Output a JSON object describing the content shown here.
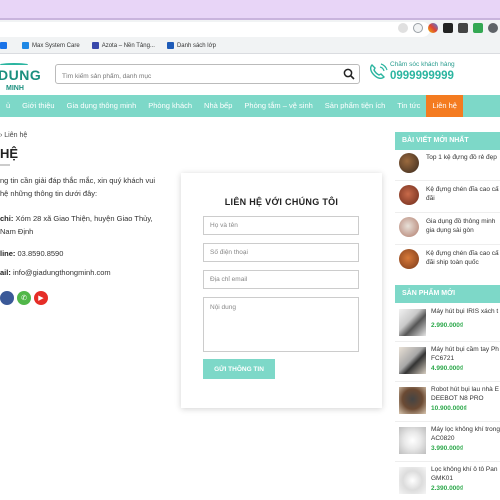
{
  "browser": {
    "bookmarks": [
      {
        "label": "",
        "color": "#1a73e8"
      },
      {
        "label": "Max System Care",
        "color": "#1e88e5"
      },
      {
        "label": "Azota – Nền Tảng...",
        "color": "#3949ab"
      },
      {
        "label": "Danh sách lớp",
        "color": "#1e5bb8"
      }
    ]
  },
  "header": {
    "logo_main": "DUNG",
    "logo_sub": "MINH",
    "search_placeholder": "Tìm kiếm sản phẩm, danh mục",
    "hotline_label": "Chăm sóc khách hàng",
    "hotline_phone": "0999999999"
  },
  "nav": {
    "items": [
      "ủ",
      "Giới thiệu",
      "Gia dụng thông minh",
      "Phòng khách",
      "Nhà bếp",
      "Phòng tắm – vệ sinh",
      "Sản phẩm tiện ích",
      "Tin tức",
      "Liên hệ"
    ],
    "active_index": 8
  },
  "content": {
    "breadcrumb": "› Liên hệ",
    "title": "HỆ",
    "intro_lines": [
      "ng tin cần giải đáp thắc mắc, xin quý khách vui",
      "hệ những thông tin dưới đây:"
    ],
    "address_label": "chỉ:",
    "address_value": "Xóm 28 xã Giao Thiện, huyện Giao Thủy,",
    "address_value2": "Nam Định",
    "hotline_label": "line:",
    "hotline_value": "03.8590.8590",
    "email_label": "ail:",
    "email_value": "info@giadungthongminh.com"
  },
  "form": {
    "title": "LIÊN HỆ VỚI CHÚNG TÔI",
    "name_placeholder": "Họ và tên",
    "phone_placeholder": "Số điện thoại",
    "email_placeholder": "Địa chỉ email",
    "message_placeholder": "Nội dung",
    "submit_label": "GỬI THÔNG TIN"
  },
  "sidebar": {
    "posts_heading": "BÀI VIẾT MỚI NHẤT",
    "posts": [
      {
        "title": "Top 1 kệ đựng đồ rẻ đẹp"
      },
      {
        "title": "Kệ đựng chén đĩa cao cấ",
        "title2": "đãi"
      },
      {
        "title": "Gia dụng đồ thông minh",
        "title2": "gia dụng sài gòn"
      },
      {
        "title": "Kệ đựng chén đĩa cao cấ",
        "title2": "đãi ship toàn quốc"
      }
    ],
    "products_heading": "SẢN PHẨM MỚI",
    "products": [
      {
        "name": "Máy hút bụi IRIS xách t",
        "name2": "",
        "price": "2.990.000₫"
      },
      {
        "name": "Máy hút bụi cầm tay Ph",
        "name2": "FC6721",
        "price": "4.990.000₫"
      },
      {
        "name": "Robot hút bụi lau nhà E",
        "name2": "DEEBOT N8 PRO",
        "price": "10.900.000₫"
      },
      {
        "name": "Máy lọc không khí trong",
        "name2": "AC0820",
        "price": "3.990.000₫"
      },
      {
        "name": "Lọc không khí ô tô Pan",
        "name2": "GMK01",
        "price": "2.390.000₫"
      }
    ]
  },
  "colors": {
    "teal": "#7dd8c8",
    "orange": "#f47b20",
    "price_green": "#2ba84a"
  }
}
